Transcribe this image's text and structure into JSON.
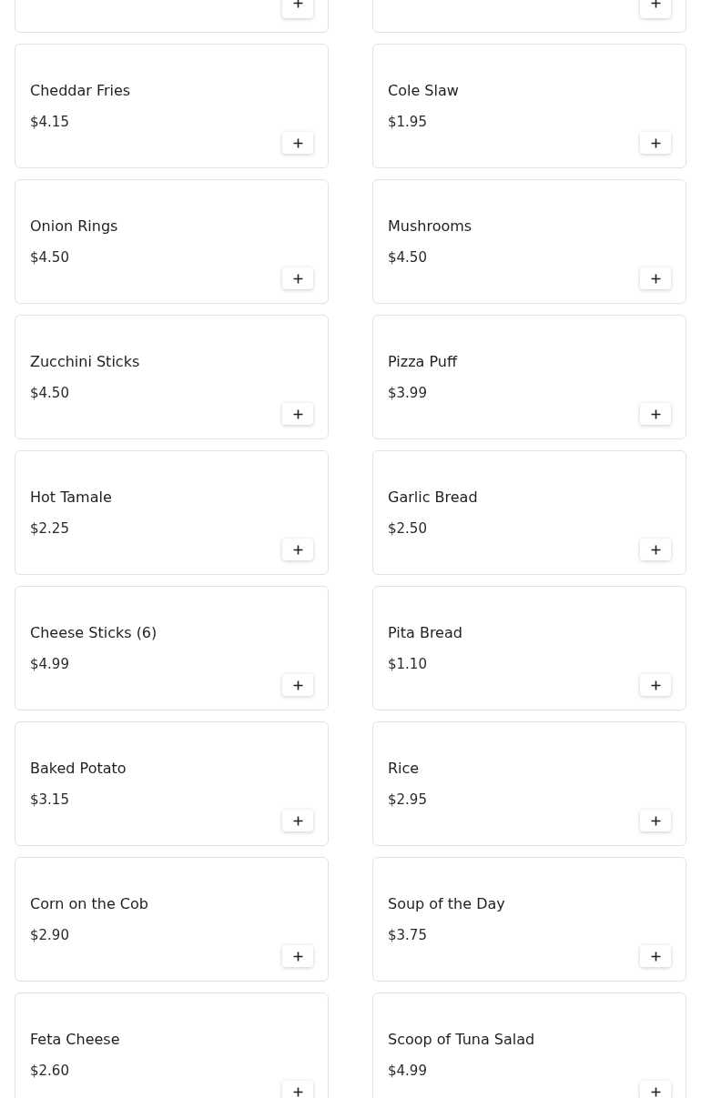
{
  "items": [
    {
      "kind": "cut"
    },
    {
      "kind": "cut"
    },
    {
      "kind": "full",
      "name": "Cheddar Fries",
      "price": "$4.15"
    },
    {
      "kind": "full",
      "name": "Cole Slaw",
      "price": "$1.95"
    },
    {
      "kind": "full",
      "name": "Onion Rings",
      "price": "$4.50"
    },
    {
      "kind": "full",
      "name": "Mushrooms",
      "price": "$4.50"
    },
    {
      "kind": "full",
      "name": "Zucchini Sticks",
      "price": "$4.50"
    },
    {
      "kind": "full",
      "name": "Pizza Puff",
      "price": "$3.99"
    },
    {
      "kind": "full",
      "name": "Hot Tamale",
      "price": "$2.25"
    },
    {
      "kind": "full",
      "name": "Garlic Bread",
      "price": "$2.50"
    },
    {
      "kind": "full",
      "name": "Cheese Sticks (6)",
      "price": "$4.99"
    },
    {
      "kind": "full",
      "name": "Pita Bread",
      "price": "$1.10"
    },
    {
      "kind": "full",
      "name": "Baked Potato",
      "price": "$3.15"
    },
    {
      "kind": "full",
      "name": "Rice",
      "price": "$2.95"
    },
    {
      "kind": "full",
      "name": "Corn on the Cob",
      "price": "$2.90"
    },
    {
      "kind": "full",
      "name": "Soup of the Day",
      "price": "$3.75"
    },
    {
      "kind": "full",
      "name": "Feta Cheese",
      "price": "$2.60"
    },
    {
      "kind": "full",
      "name": "Scoop of Tuna Salad",
      "price": "$4.99"
    }
  ]
}
